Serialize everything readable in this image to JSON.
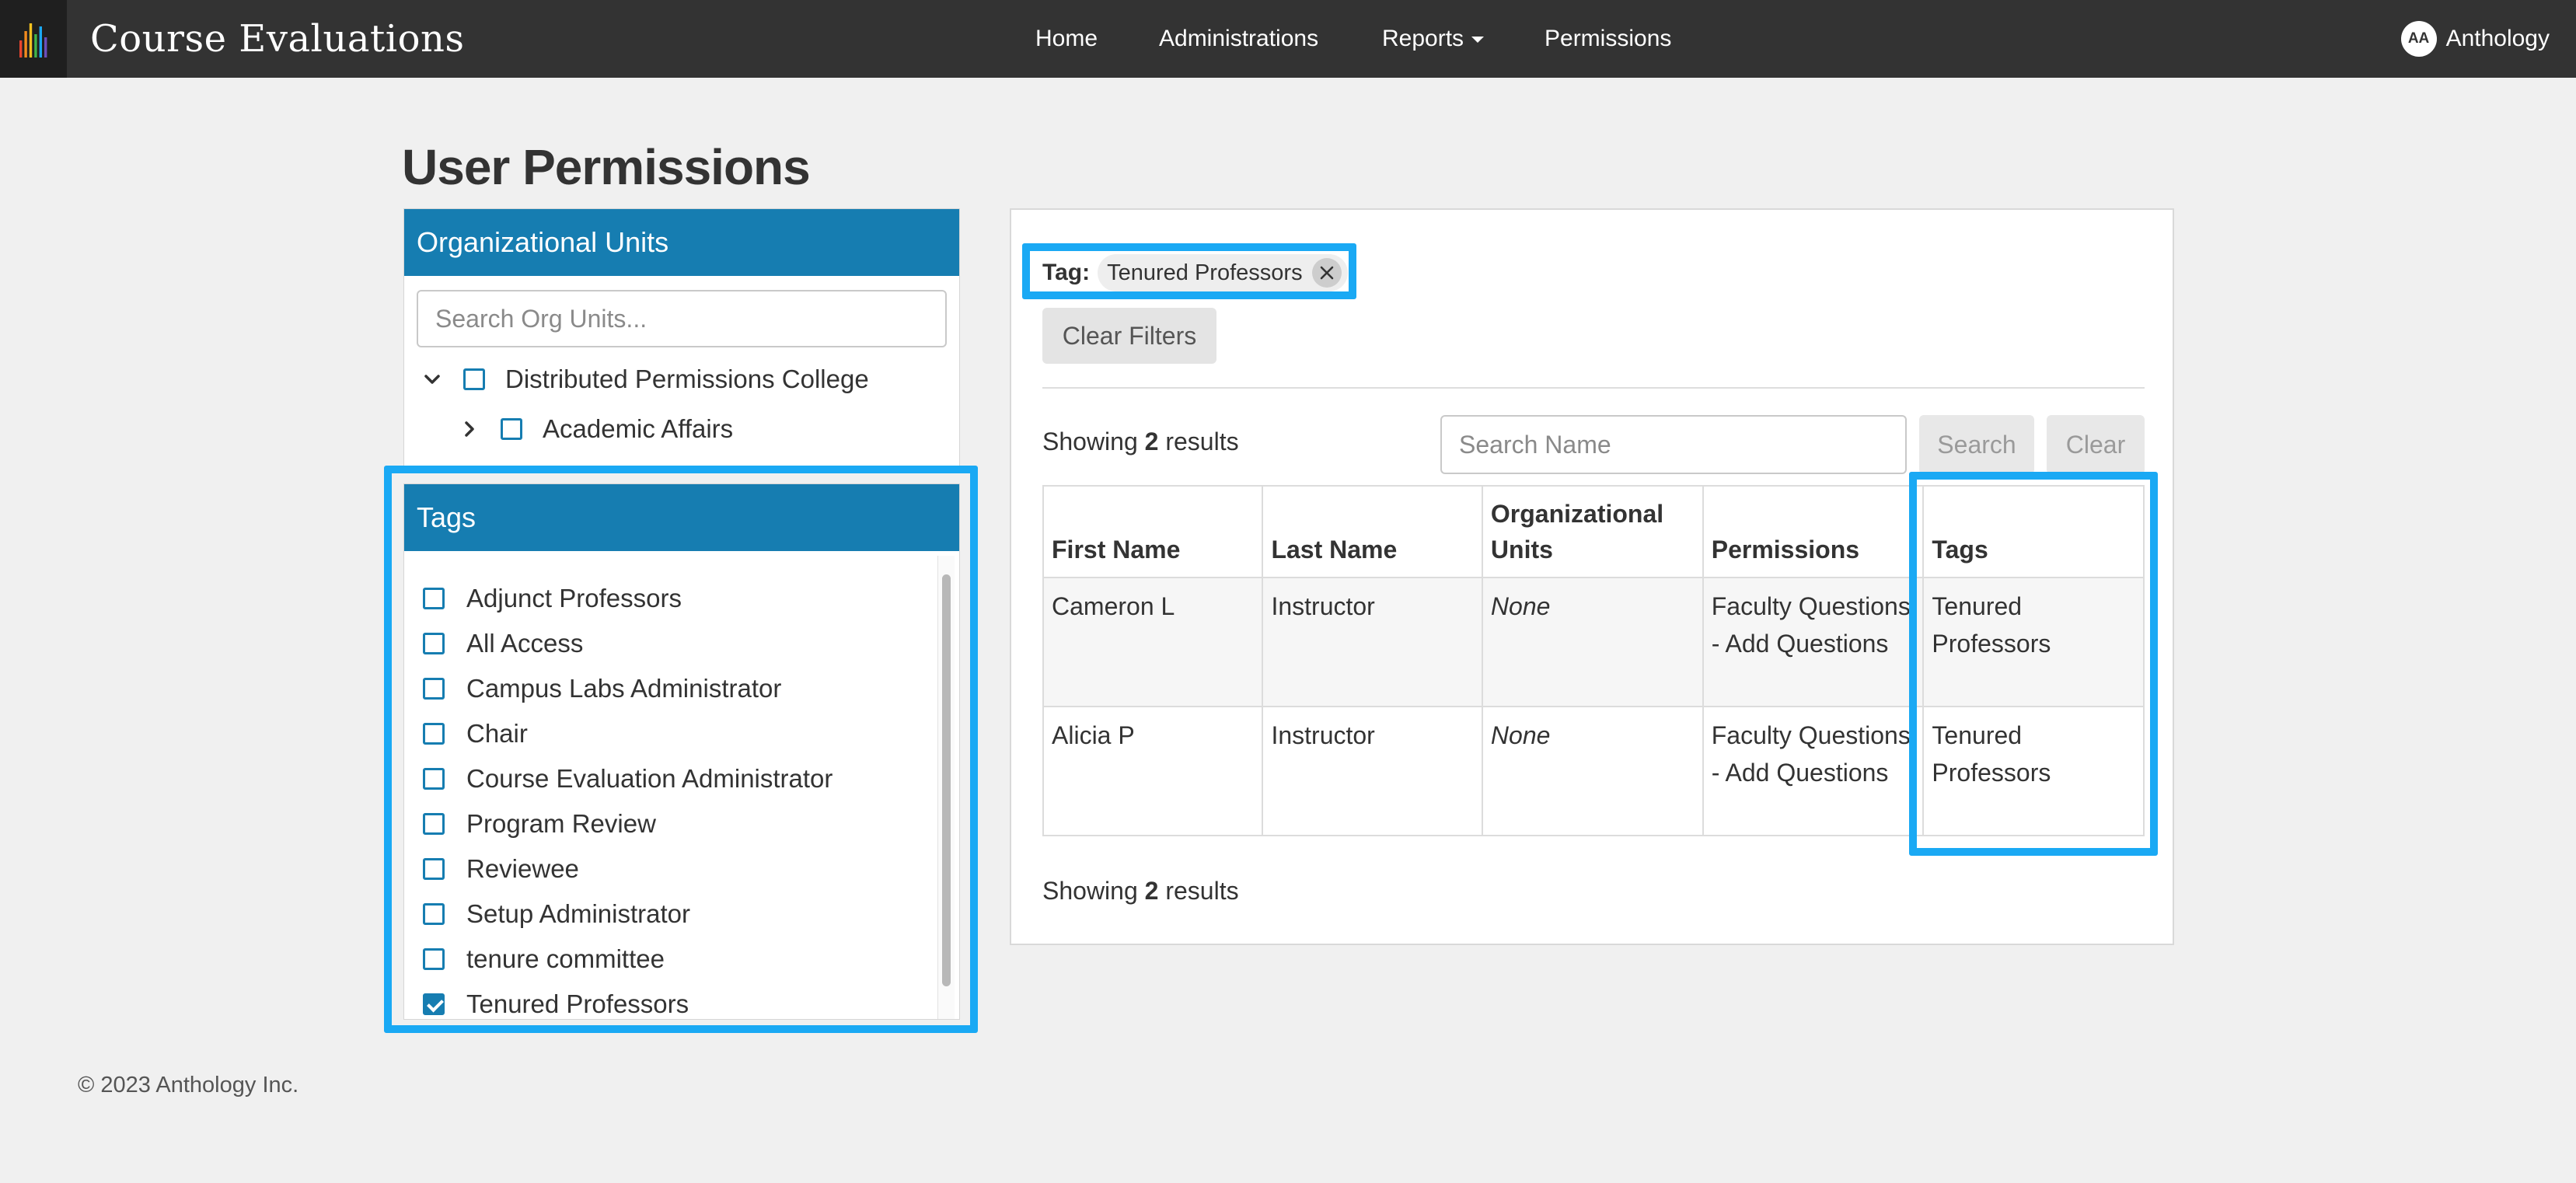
{
  "header": {
    "app_title": "Course Evaluations",
    "nav": [
      {
        "label": "Home"
      },
      {
        "label": "Administrations"
      },
      {
        "label": "Reports"
      },
      {
        "label": "Permissions"
      }
    ],
    "user": {
      "initials": "AA",
      "name": "Anthology"
    }
  },
  "page": {
    "title": "User Permissions"
  },
  "org_units": {
    "title": "Organizational Units",
    "search_placeholder": "Search Org Units...",
    "tree": [
      {
        "label": "Distributed Permissions College",
        "expanded": true,
        "checked": false
      },
      {
        "label": "Academic Affairs",
        "expanded": false,
        "checked": false
      }
    ]
  },
  "tags": {
    "title": "Tags",
    "items": [
      {
        "label": "Adjunct Professors",
        "checked": false
      },
      {
        "label": "All Access",
        "checked": false
      },
      {
        "label": "Campus Labs Administrator",
        "checked": false
      },
      {
        "label": "Chair",
        "checked": false
      },
      {
        "label": "Course Evaluation Administrator",
        "checked": false
      },
      {
        "label": "Program Review",
        "checked": false
      },
      {
        "label": "Reviewee",
        "checked": false
      },
      {
        "label": "Setup Administrator",
        "checked": false
      },
      {
        "label": "tenure committee",
        "checked": false
      },
      {
        "label": "Tenured Professors",
        "checked": true
      }
    ]
  },
  "results": {
    "active_filter": {
      "label": "Tag:",
      "value": "Tenured Professors"
    },
    "clear_filters_label": "Clear Filters",
    "showing_prefix": "Showing",
    "count": "2",
    "showing_suffix": "results",
    "search_placeholder": "Search Name",
    "search_label": "Search",
    "clear_label": "Clear",
    "columns": [
      "First Name",
      "Last Name",
      "Organizational Units",
      "Permissions",
      "Tags"
    ],
    "rows": [
      {
        "first": "Cameron L",
        "last": "Instructor",
        "org": "None",
        "permissions": "Faculty Questions - Add Questions",
        "tags": "Tenured Professors"
      },
      {
        "first": "Alicia P",
        "last": "Instructor",
        "org": "None",
        "permissions": "Faculty Questions - Add Questions",
        "tags": "Tenured Professors"
      }
    ]
  },
  "footer": {
    "copyright": "© 2023 Anthology Inc."
  },
  "colors": {
    "topbar": "#333333",
    "panel_header": "#167db1",
    "highlight": "#1aa9f4",
    "logo_bars": [
      "#e8442e",
      "#f28b1e",
      "#f4c21f",
      "#41b549",
      "#1aa9f4",
      "#6b4fbb"
    ]
  }
}
